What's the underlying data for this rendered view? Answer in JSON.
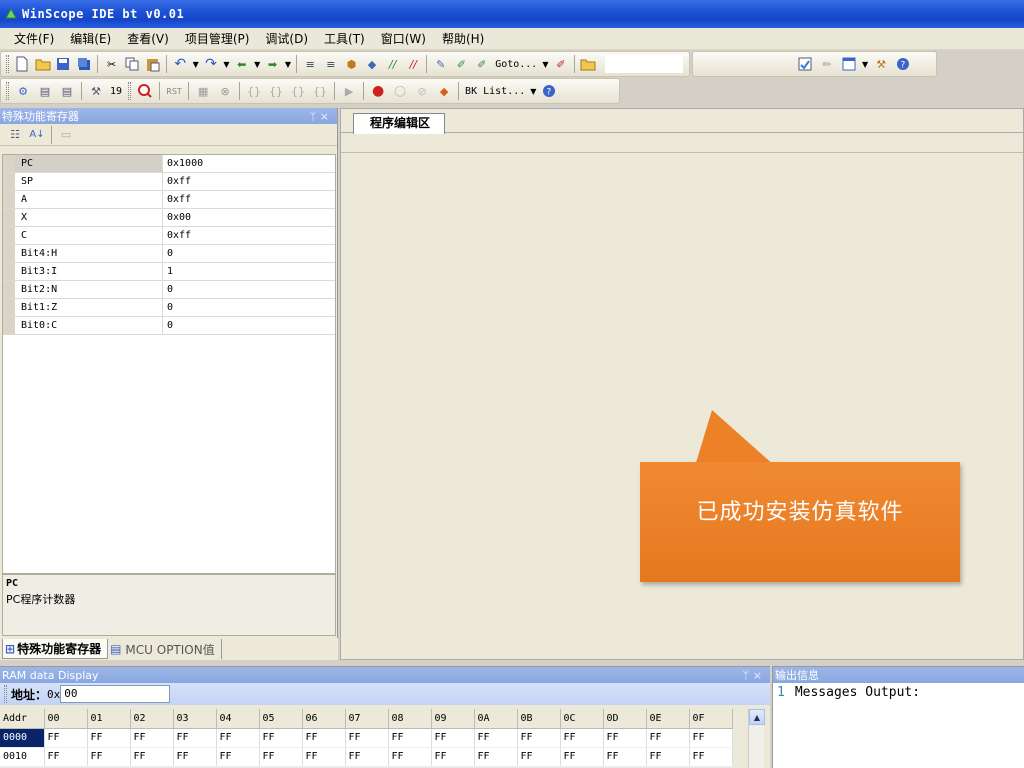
{
  "window": {
    "title": "WinScope IDE bt v0.01"
  },
  "menu": [
    "文件(F)",
    "编辑(E)",
    "查看(V)",
    "项目管理(P)",
    "调试(D)",
    "工具(T)",
    "窗口(W)",
    "帮助(H)"
  ],
  "toolbar": {
    "goto_label": "Goto...",
    "bklist_label": "BK List...",
    "tab_stop_value": "19"
  },
  "left_panel": {
    "title": "特殊功能寄存器",
    "controls": "ᛘ ×",
    "registers": [
      {
        "name": "PC",
        "value": "0x1000"
      },
      {
        "name": "SP",
        "value": "0xff"
      },
      {
        "name": "A",
        "value": "0xff"
      },
      {
        "name": "X",
        "value": "0x00"
      },
      {
        "name": "C",
        "value": "0xff"
      },
      {
        "name": "Bit4:H",
        "value": "0"
      },
      {
        "name": "Bit3:I",
        "value": "1"
      },
      {
        "name": "Bit2:N",
        "value": "0"
      },
      {
        "name": "Bit1:Z",
        "value": "0"
      },
      {
        "name": "Bit0:C",
        "value": "0"
      }
    ],
    "desc_title": "PC",
    "desc_text": "PC程序计数器",
    "tabs": [
      "特殊功能寄存器",
      "MCU OPTION值"
    ]
  },
  "editor": {
    "tab": "程序编辑区"
  },
  "callout": {
    "text": "已成功安装仿真软件",
    "color": "#ec8128"
  },
  "ram_panel": {
    "title": "RAM data Display",
    "controls": "ᛘ ×",
    "addr_label": "地址：",
    "addr_prefix": "0x",
    "addr_value": "00",
    "headers": [
      "Addr",
      "00",
      "01",
      "02",
      "03",
      "04",
      "05",
      "06",
      "07",
      "08",
      "09",
      "0A",
      "0B",
      "0C",
      "0D",
      "0E",
      "0F"
    ],
    "rows": [
      {
        "addr": "0000",
        "cells": [
          "FF",
          "FF",
          "FF",
          "FF",
          "FF",
          "FF",
          "FF",
          "FF",
          "FF",
          "FF",
          "FF",
          "FF",
          "FF",
          "FF",
          "FF",
          "FF"
        ]
      },
      {
        "addr": "0010",
        "cells": [
          "FF",
          "FF",
          "FF",
          "FF",
          "FF",
          "FF",
          "FF",
          "FF",
          "FF",
          "FF",
          "FF",
          "FF",
          "FF",
          "FF",
          "FF",
          "FF"
        ]
      }
    ]
  },
  "output_panel": {
    "title": "输出信息",
    "line_no": "1",
    "text": "Messages Output:"
  },
  "colors": {
    "titlebar": "#1d52d4",
    "panel_header": "#89a8e0",
    "selection": "#0a246a",
    "callout": "#ec8128"
  }
}
